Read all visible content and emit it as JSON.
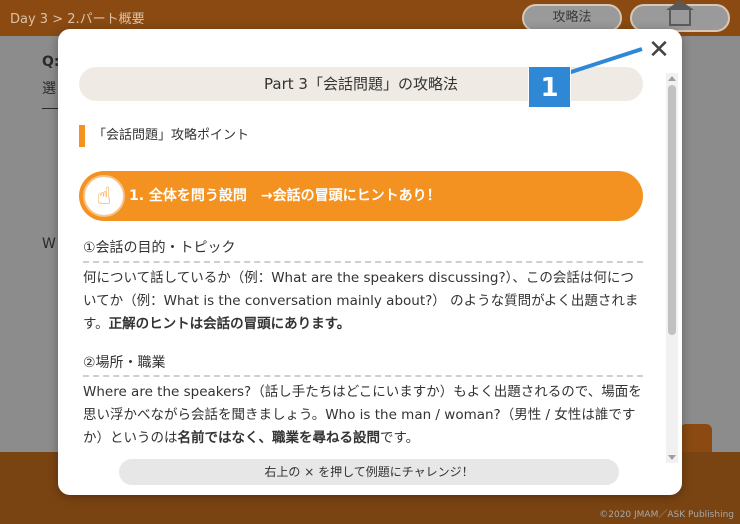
{
  "header": {
    "breadcrumb": "Day 3 > 2.パート概要",
    "strategy_button": "攻略法",
    "home_label": "ホーム"
  },
  "background": {
    "question_label": "Q:",
    "select_text": "選",
    "body_initial": "W"
  },
  "modal": {
    "title": "Part 3「会話問題」の攻略法",
    "badge_number": "1",
    "section_title": "「会話問題」攻略ポイント",
    "banner": "1. 全体を問う設問　→会話の冒頭にヒントあり！",
    "items": [
      {
        "heading": "①会話の目的・トピック",
        "text_plain": "何について話しているか（例：What are the speakers discussing?）、この会話は何についてか（例：What is the conversation mainly about?） のような質問がよく出題されます。",
        "text_bold": "正解のヒントは会話の冒頭にあります。",
        "text_tail": ""
      },
      {
        "heading": "②場所・職業",
        "text_plain": "Where are the speakers?（話し手たちはどこにいますか）もよく出題されるので、場面を思い浮かべながら会話を聞きましょう。Who is the man / woman?（男性 / 女性は誰ですか）というのは",
        "text_bold": "名前ではなく、職業を尋ねる設問",
        "text_tail": "です。"
      }
    ],
    "footer_note": "右上の × を押して例題にチャレンジ！"
  },
  "copyright": "©2020 JMAM／ASK Publishing",
  "colors": {
    "accent_orange": "#f39221",
    "badge_blue": "#2e88d6",
    "header_brown": "#8a4a12"
  },
  "icons": {
    "close": "close-icon",
    "hand": "pointing-hand-icon",
    "home": "home-icon"
  }
}
